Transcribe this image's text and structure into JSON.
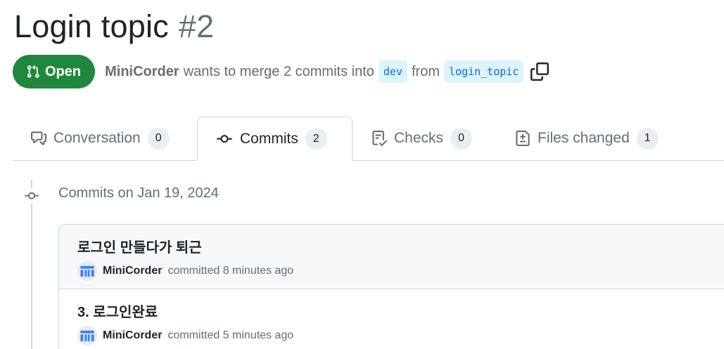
{
  "pr": {
    "title": "Login topic",
    "number": "#2",
    "state": "Open",
    "author": "MiniCorder",
    "merge_text": "wants to merge 2 commits into",
    "base_branch": "dev",
    "from_text": "from",
    "head_branch": "login_topic"
  },
  "tabs": [
    {
      "label": "Conversation",
      "count": "0",
      "icon": "comment-discussion-icon"
    },
    {
      "label": "Commits",
      "count": "2",
      "icon": "git-commit-icon",
      "active": true
    },
    {
      "label": "Checks",
      "count": "0",
      "icon": "checklist-icon"
    },
    {
      "label": "Files changed",
      "count": "1",
      "icon": "file-diff-icon"
    }
  ],
  "commits_group": {
    "heading": "Commits on Jan 19, 2024"
  },
  "commits": [
    {
      "message": "로그인 만들다가 퇴근",
      "author": "MiniCorder",
      "time": "committed 8 minutes ago"
    },
    {
      "message": "3. 로그인완료",
      "author": "MiniCorder",
      "time": "committed 5 minutes ago"
    }
  ],
  "colors": {
    "open_green": "#1f883d",
    "branch_blue": "#0969da",
    "branch_bg": "#ddf4ff",
    "muted_text": "#656d76",
    "avatar_blue": "#3d7ff0"
  }
}
